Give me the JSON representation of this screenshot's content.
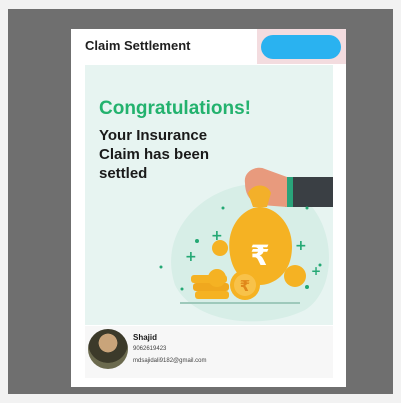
{
  "header": {
    "title": "Claim Settlement"
  },
  "banner": {
    "headline": "Congratulations!",
    "message_lines": [
      "Your Insurance",
      "Claim has been",
      "settled"
    ],
    "currency_symbol": "₹"
  },
  "profile": {
    "name": "Shajid",
    "phone": "9062619423",
    "email": "mdsajidali9182@gmail.com"
  },
  "colors": {
    "headline": "#23b26e",
    "banner_bg": "#e7f4f1",
    "coin": "#f5b223",
    "redaction": "#2ab2f0"
  }
}
